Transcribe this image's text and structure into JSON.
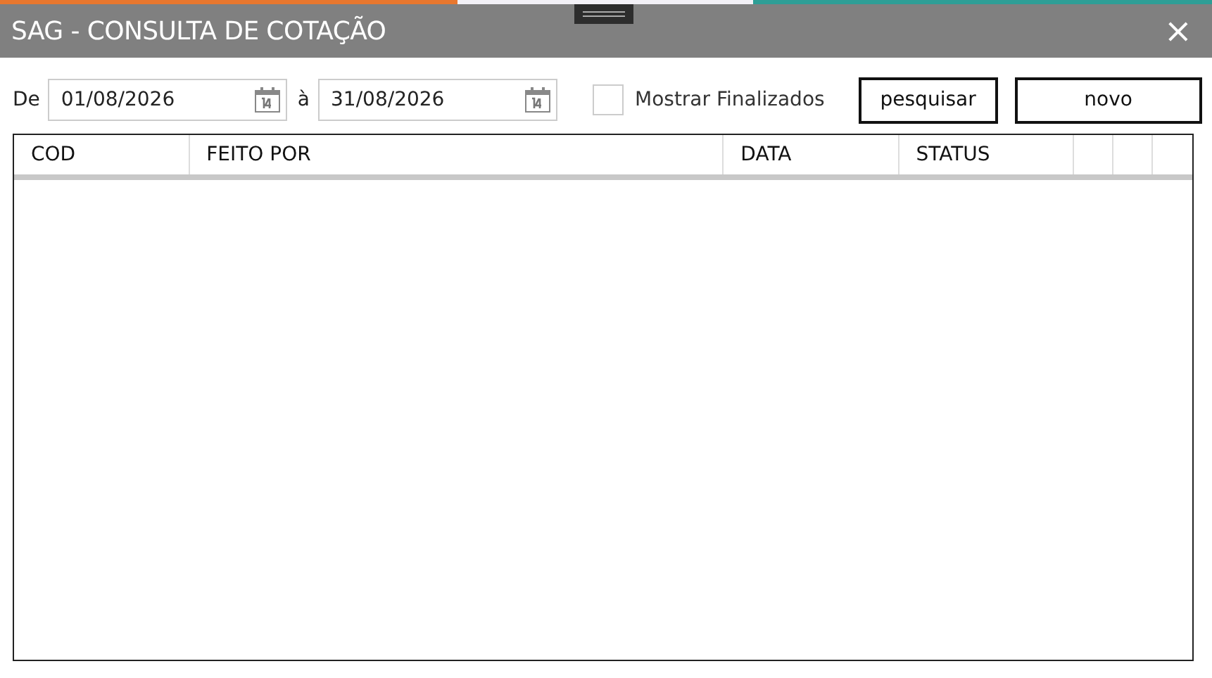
{
  "window": {
    "title": "SAG - CONSULTA DE COTAÇÃO",
    "close": "×"
  },
  "filters": {
    "from_label": "De",
    "from_date": "01/08/2026",
    "to_label": "à",
    "to_date": "31/08/2026",
    "show_finished": {
      "label": "Mostrar Finalizados",
      "checked": false
    }
  },
  "buttons": [
    "pesquisar",
    "novo"
  ],
  "table": {
    "columns": [
      "COD",
      "FEITO POR",
      "DATA",
      "STATUS"
    ]
  }
}
